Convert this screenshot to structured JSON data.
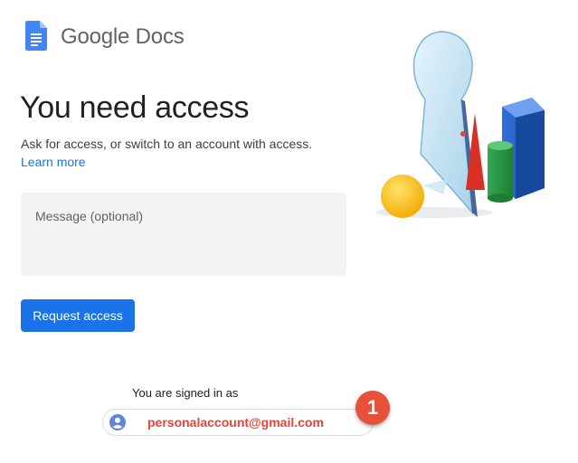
{
  "header": {
    "brand_name": "Google Docs",
    "icon": "google-docs-icon"
  },
  "main": {
    "title": "You need access",
    "subtitle": "Ask for access, or switch to an account with access.",
    "learn_more": "Learn more",
    "message_placeholder": "Message (optional)",
    "message_value": "",
    "request_button": "Request access"
  },
  "account": {
    "signed_in_label": "You are signed in as",
    "email": "personalaccount@gmail.com",
    "avatar_icon": "account-circle-icon"
  },
  "annotation": {
    "badge_number": "1"
  },
  "colors": {
    "accent": "#1a73e8",
    "docs_blue": "#4285f4",
    "email_red": "#ea4335",
    "badge": "#e8503a",
    "input_bg": "#f1f3f4"
  }
}
